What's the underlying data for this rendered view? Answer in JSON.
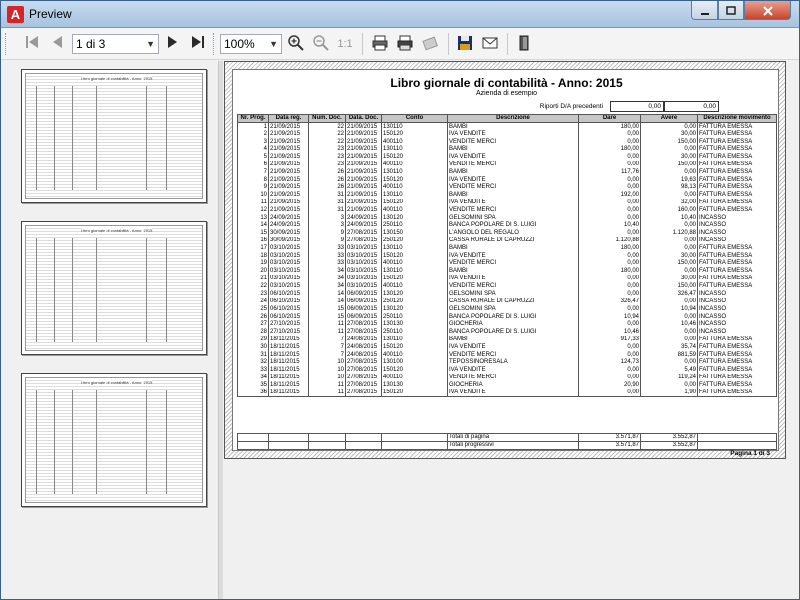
{
  "window": {
    "title": "Preview",
    "app_icon": "A"
  },
  "toolbar": {
    "page_value": "1 di 3",
    "zoom_value": "100%",
    "actual_size": "1:1"
  },
  "report": {
    "title": "Libro giornale di contabilità - Anno: 2015",
    "company": "Azienda di esempio",
    "riporti_label": "Riporti D/A precedenti",
    "riporto_dare": "0,00",
    "riporto_avere": "0,00",
    "columns": [
      "Nr. Prog.",
      "Data reg.",
      "Num. Doc.",
      "Data. Doc.",
      "Conto",
      "Descrizione",
      "Dare",
      "Avere",
      "Descrizione movimento"
    ],
    "rows": [
      [
        "1",
        "21/09/2015",
        "22",
        "21/09/2015",
        "130110",
        "BAMBI",
        "180,00",
        "0,00",
        "FATTURA EMESSA"
      ],
      [
        "2",
        "21/09/2015",
        "22",
        "21/09/2015",
        "150120",
        "IVA VENDITE",
        "0,00",
        "30,00",
        "FATTURA EMESSA"
      ],
      [
        "3",
        "21/09/2015",
        "22",
        "21/09/2015",
        "400110",
        "VENDITE MERCI",
        "0,00",
        "150,00",
        "FATTURA EMESSA"
      ],
      [
        "4",
        "21/09/2015",
        "23",
        "21/09/2015",
        "130110",
        "BAMBI",
        "180,00",
        "0,00",
        "FATTURA EMESSA"
      ],
      [
        "5",
        "21/09/2015",
        "23",
        "21/09/2015",
        "150120",
        "IVA VENDITE",
        "0,00",
        "30,00",
        "FATTURA EMESSA"
      ],
      [
        "6",
        "21/09/2015",
        "23",
        "21/09/2015",
        "400110",
        "VENDITE MERCI",
        "0,00",
        "150,00",
        "FATTURA EMESSA"
      ],
      [
        "7",
        "21/09/2015",
        "26",
        "21/09/2015",
        "130110",
        "BAMBI",
        "117,76",
        "0,00",
        "FATTURA EMESSA"
      ],
      [
        "8",
        "21/09/2015",
        "26",
        "21/09/2015",
        "150120",
        "IVA VENDITE",
        "0,00",
        "19,63",
        "FATTURA EMESSA"
      ],
      [
        "9",
        "21/09/2015",
        "26",
        "21/09/2015",
        "400110",
        "VENDITE MERCI",
        "0,00",
        "98,13",
        "FATTURA EMESSA"
      ],
      [
        "10",
        "21/09/2015",
        "31",
        "21/09/2015",
        "130110",
        "BAMBI",
        "192,00",
        "0,00",
        "FATTURA EMESSA"
      ],
      [
        "11",
        "21/09/2015",
        "31",
        "21/09/2015",
        "150120",
        "IVA VENDITE",
        "0,00",
        "32,00",
        "FATTURA EMESSA"
      ],
      [
        "12",
        "21/09/2015",
        "31",
        "21/09/2015",
        "400110",
        "VENDITE MERCI",
        "0,00",
        "160,00",
        "FATTURA EMESSA"
      ],
      [
        "13",
        "24/09/2015",
        "3",
        "24/09/2015",
        "130120",
        "GELSOMINI SPA",
        "0,00",
        "10,40",
        "INCASSO"
      ],
      [
        "14",
        "24/09/2015",
        "3",
        "24/09/2015",
        "250110",
        "BANCA POPOLARE DI S. LUIGI",
        "10,40",
        "0,00",
        "INCASSO"
      ],
      [
        "15",
        "30/09/2015",
        "9",
        "27/08/2015",
        "130150",
        "L'ANGOLO DEL REGALO",
        "0,00",
        "1.120,88",
        "INCASSO"
      ],
      [
        "16",
        "30/09/2015",
        "9",
        "27/08/2015",
        "250120",
        "CASSA RURALE DI CAPRUZZI",
        "1.120,88",
        "0,00",
        "INCASSO"
      ],
      [
        "17",
        "03/10/2015",
        "33",
        "03/10/2015",
        "130110",
        "BAMBI",
        "180,00",
        "0,00",
        "FATTURA EMESSA"
      ],
      [
        "18",
        "03/10/2015",
        "33",
        "03/10/2015",
        "150120",
        "IVA VENDITE",
        "0,00",
        "30,00",
        "FATTURA EMESSA"
      ],
      [
        "19",
        "03/10/2015",
        "33",
        "03/10/2015",
        "400110",
        "VENDITE MERCI",
        "0,00",
        "150,00",
        "FATTURA EMESSA"
      ],
      [
        "20",
        "03/10/2015",
        "34",
        "03/10/2015",
        "130110",
        "BAMBI",
        "180,00",
        "0,00",
        "FATTURA EMESSA"
      ],
      [
        "21",
        "03/10/2015",
        "34",
        "03/10/2015",
        "150120",
        "IVA VENDITE",
        "0,00",
        "30,00",
        "FATTURA EMESSA"
      ],
      [
        "22",
        "03/10/2015",
        "34",
        "03/10/2015",
        "400110",
        "VENDITE MERCI",
        "0,00",
        "150,00",
        "FATTURA EMESSA"
      ],
      [
        "23",
        "06/10/2015",
        "14",
        "06/09/2015",
        "130120",
        "GELSOMINI SPA",
        "0,00",
        "326,47",
        "INCASSO"
      ],
      [
        "24",
        "06/10/2015",
        "14",
        "06/09/2015",
        "250120",
        "CASSA RURALE DI CAPRUZZI",
        "326,47",
        "0,00",
        "INCASSO"
      ],
      [
        "25",
        "06/10/2015",
        "15",
        "06/09/2015",
        "130120",
        "GELSOMINI SPA",
        "0,00",
        "10,94",
        "INCASSO"
      ],
      [
        "26",
        "06/10/2015",
        "15",
        "06/09/2015",
        "250110",
        "BANCA POPOLARE DI S. LUIGI",
        "10,94",
        "0,00",
        "INCASSO"
      ],
      [
        "27",
        "27/10/2015",
        "11",
        "27/08/2015",
        "130130",
        "GIOCHERIA",
        "0,00",
        "10,46",
        "INCASSO"
      ],
      [
        "28",
        "27/10/2015",
        "11",
        "27/08/2015",
        "250110",
        "BANCA POPOLARE DI S. LUIGI",
        "10,46",
        "0,00",
        "INCASSO"
      ],
      [
        "29",
        "18/11/2015",
        "7",
        "24/08/2015",
        "130110",
        "BAMBI",
        "917,33",
        "0,00",
        "FATTURA EMESSA"
      ],
      [
        "30",
        "18/11/2015",
        "7",
        "24/08/2015",
        "150120",
        "IVA VENDITE",
        "0,00",
        "35,74",
        "FATTURA EMESSA"
      ],
      [
        "31",
        "18/11/2015",
        "7",
        "24/08/2015",
        "400110",
        "VENDITE MERCI",
        "0,00",
        "881,59",
        "FATTURA EMESSA"
      ],
      [
        "32",
        "18/11/2015",
        "10",
        "27/08/2015",
        "130100",
        "TEPOSSINORESALA",
        "124,73",
        "0,00",
        "FATTURA EMESSA"
      ],
      [
        "33",
        "18/11/2015",
        "10",
        "27/08/2015",
        "150120",
        "IVA VENDITE",
        "0,00",
        "5,49",
        "FATTURA EMESSA"
      ],
      [
        "34",
        "18/11/2015",
        "10",
        "27/08/2015",
        "400110",
        "VENDITE MERCI",
        "0,00",
        "119,24",
        "FATTURA EMESSA"
      ],
      [
        "35",
        "18/11/2015",
        "11",
        "27/08/2015",
        "130130",
        "GIOCHERIA",
        "20,90",
        "0,00",
        "FATTURA EMESSA"
      ],
      [
        "36",
        "18/11/2015",
        "11",
        "27/08/2015",
        "150120",
        "IVA VENDITE",
        "0,00",
        "1,90",
        "FATTURA EMESSA"
      ]
    ],
    "totals_page_label": "Totali di pagina",
    "totals_page_dare": "3.571,87",
    "totals_page_avere": "3.552,87",
    "totals_prog_label": "Totali progressivi",
    "totals_prog_dare": "3.571,87",
    "totals_prog_avere": "3.552,87",
    "page_label": "Pagina 1 di 3"
  }
}
